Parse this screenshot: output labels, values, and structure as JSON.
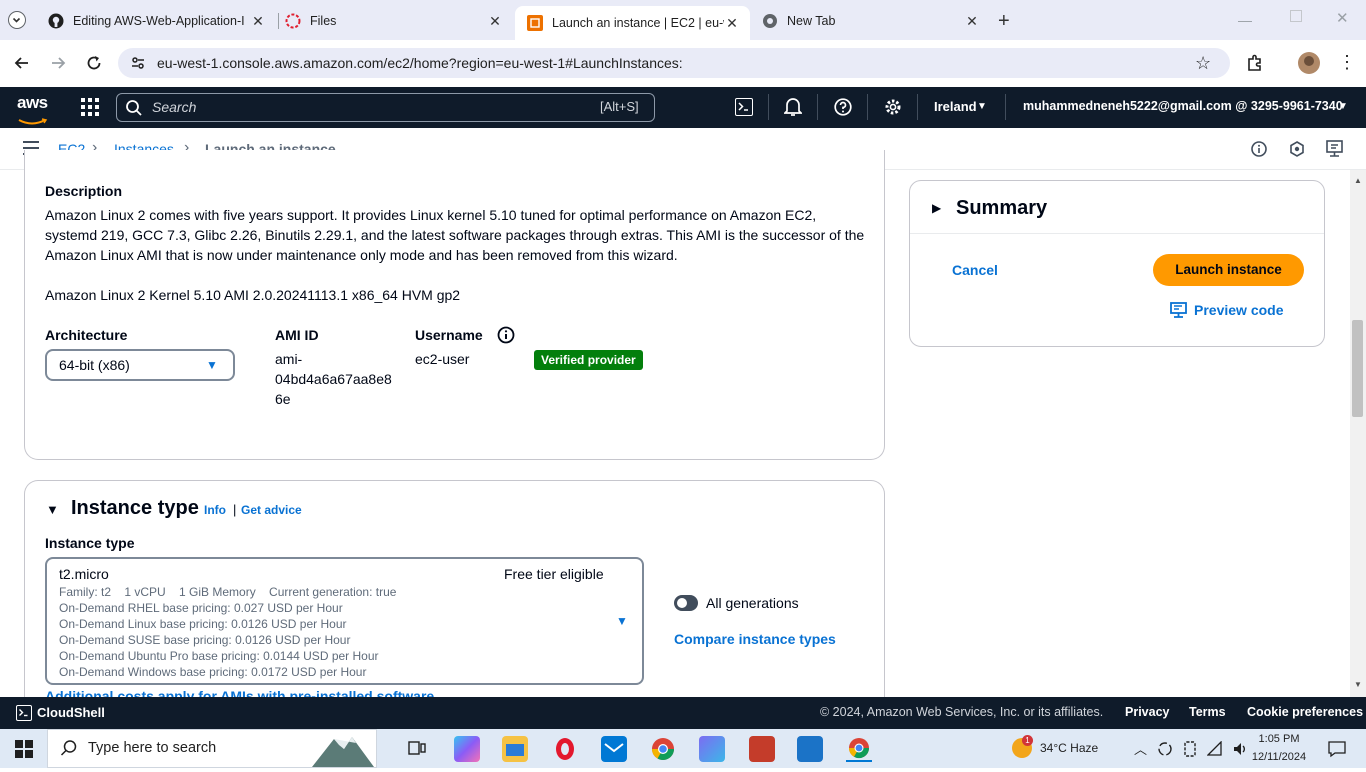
{
  "browser": {
    "tabs": [
      {
        "title": "Editing AWS-Web-Application-I",
        "icon": "github-icon",
        "active": false
      },
      {
        "title": "Files",
        "icon": "files-icon",
        "active": false
      },
      {
        "title": "Launch an instance | EC2 | eu-w",
        "icon": "aws-ec2-icon",
        "active": true
      },
      {
        "title": "New Tab",
        "icon": "chrome-icon",
        "active": false
      }
    ],
    "url": "eu-west-1.console.aws.amazon.com/ec2/home?region=eu-west-1#LaunchInstances:"
  },
  "aws_nav": {
    "logo": "aws",
    "search_placeholder": "Search",
    "search_shortcut": "[Alt+S]",
    "region": "Ireland",
    "account": "muhammedneneh5222@gmail.com @ 3295-9961-7340"
  },
  "breadcrumb": {
    "items": [
      "EC2",
      "Instances",
      "Launch an instance"
    ]
  },
  "ami": {
    "description_label": "Description",
    "description": "Amazon Linux 2 comes with five years support. It provides Linux kernel 5.10 tuned for optimal performance on Amazon EC2, systemd 219, GCC 7.3, Glibc 2.26, Binutils 2.29.1, and the latest software packages through extras. This AMI is the successor of the Amazon Linux AMI that is now under maintenance only mode and has been removed from this wizard.",
    "name": "Amazon Linux 2 Kernel 5.10 AMI 2.0.20241113.1 x86_64 HVM gp2",
    "architecture_label": "Architecture",
    "architecture_value": "64-bit (x86)",
    "ami_id_label": "AMI ID",
    "ami_id_lines": [
      "ami-",
      "04bd4a6a67aa8e8",
      "6e"
    ],
    "username_label": "Username",
    "username_value": "ec2-user",
    "verified_badge": "Verified provider"
  },
  "instance_type": {
    "heading": "Instance type",
    "info_link": "Info",
    "separator": "|",
    "advice_link": "Get advice",
    "field_label": "Instance type",
    "selected": "t2.micro",
    "free_tier": "Free tier eligible",
    "details": [
      "Family: t2    1 vCPU    1 GiB Memory    Current generation: true",
      "On-Demand RHEL base pricing: 0.027 USD per Hour",
      "On-Demand Linux base pricing: 0.0126 USD per Hour",
      "On-Demand SUSE base pricing: 0.0126 USD per Hour",
      "On-Demand Ubuntu Pro base pricing: 0.0144 USD per Hour",
      "On-Demand Windows base pricing: 0.0172 USD per Hour"
    ],
    "all_generations": "All generations",
    "compare": "Compare instance types",
    "cutoff_text": "Additional costs apply for AMIs with pre-installed software"
  },
  "summary": {
    "heading": "Summary",
    "cancel": "Cancel",
    "launch": "Launch instance",
    "preview": "Preview code"
  },
  "footer": {
    "cloudshell": "CloudShell",
    "copyright": "© 2024, Amazon Web Services, Inc. or its affiliates.",
    "links": [
      "Privacy",
      "Terms",
      "Cookie preferences"
    ]
  },
  "taskbar": {
    "search_placeholder": "Type here to search",
    "weather": "34°C Haze",
    "time": "1:05 PM",
    "date": "12/11/2024",
    "notification_count": "1"
  },
  "colors": {
    "aws_nav_bg": "#0f1b2a",
    "link": "#0972d3",
    "launch_button": "#ff9900",
    "badge_green": "#037f0c"
  }
}
